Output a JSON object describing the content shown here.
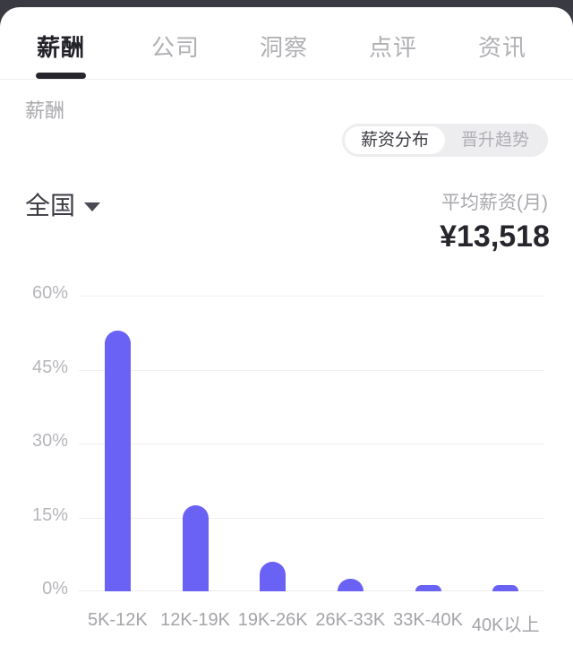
{
  "tabs": [
    {
      "label": "薪酬",
      "active": true
    },
    {
      "label": "公司",
      "active": false
    },
    {
      "label": "洞察",
      "active": false
    },
    {
      "label": "点评",
      "active": false
    },
    {
      "label": "资讯",
      "active": false
    }
  ],
  "section": {
    "label": "薪酬",
    "segments": [
      {
        "label": "薪资分布",
        "selected": true
      },
      {
        "label": "晋升趋势",
        "selected": false
      }
    ]
  },
  "meta": {
    "region": "全国",
    "caret_icon": "chevron-down-icon",
    "avg_label": "平均薪资(月)",
    "avg_value": "¥13,518"
  },
  "colors": {
    "bar": "#6a61f5",
    "accent_dark": "#26262c",
    "muted": "#a9a9ae",
    "grid": "#f0f0f2",
    "segment_track": "#ededf0",
    "frame": "#3a3a42"
  },
  "chart_data": {
    "type": "bar",
    "title": "",
    "xlabel": "",
    "ylabel": "",
    "categories": [
      "5K-12K",
      "12K-19K",
      "19K-26K",
      "26K-33K",
      "33K-40K",
      "40K以上"
    ],
    "values": [
      53,
      17.5,
      6,
      2.5,
      1.2,
      1.2
    ],
    "ylim": [
      0,
      60
    ],
    "yticks": [
      0,
      15,
      30,
      45,
      60
    ],
    "ytick_labels": [
      "0%",
      "15%",
      "30%",
      "45%",
      "60%"
    ],
    "grid": true,
    "legend": "none",
    "value_unit": "%"
  }
}
